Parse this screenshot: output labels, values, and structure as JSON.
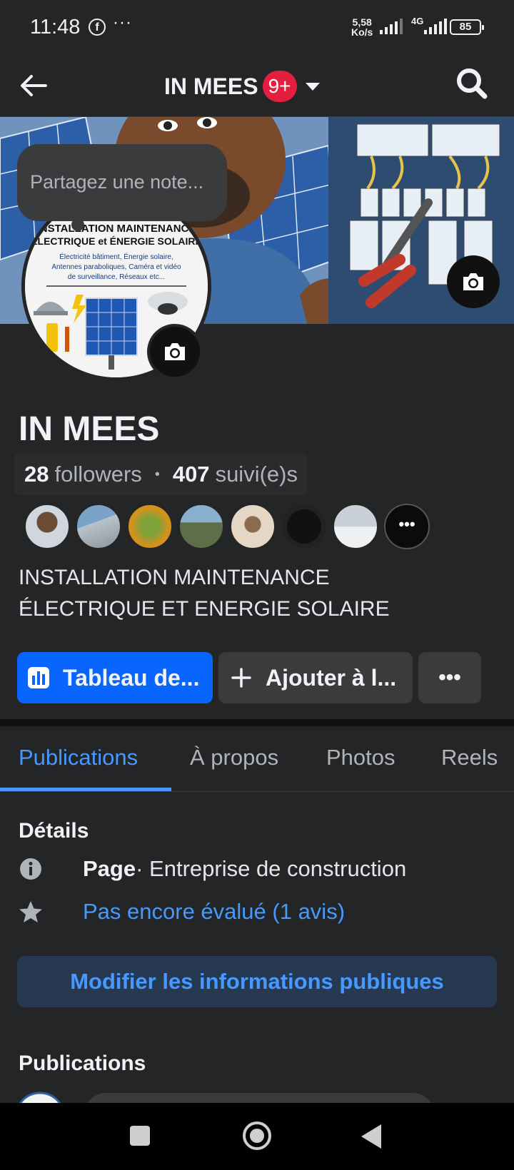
{
  "status_bar": {
    "time": "11:48",
    "fb_glyph": "f",
    "overflow": "···",
    "net_speed_value": "5,58",
    "net_speed_unit": "Ko/s",
    "network": "4G",
    "battery": "85"
  },
  "header": {
    "title": "IN MEES",
    "badge": "9+"
  },
  "cover": {
    "note_placeholder": "Partagez une note...",
    "avatar_lines": [
      "INSTALLATION MAINTENANCE",
      "ÉLECTRIQUE et ÉNERGIE SOLAIRE",
      "Électricité bâtiment, Énergie solaire,",
      "Antennes paraboliques, Caméra et vidéo",
      "de surveillance, Réseaux etc..."
    ]
  },
  "profile": {
    "name": "IN MEES",
    "followers_count": "28",
    "followers_label": "followers",
    "separator": "•",
    "following_count": "407",
    "following_label": "suivi(e)s",
    "more_friends": "•••",
    "bio_line1": "INSTALLATION MAINTENANCE",
    "bio_line2": "ÉLECTRIQUE ET ENERGIE SOLAIRE"
  },
  "actions": {
    "dashboard": "Tableau de...",
    "add": "Ajouter à l...",
    "more": "•••"
  },
  "tabs": [
    "Publications",
    "À propos",
    "Photos",
    "Reels"
  ],
  "details": {
    "title": "Détails",
    "page_label": "Page",
    "page_category": " · Entreprise de construction",
    "rating": "Pas encore évalué (1 avis)",
    "edit_button": "Modifier les informations publiques"
  },
  "publications_title": "Publications",
  "colors": {
    "accent": "#0866ff",
    "link": "#4599ff",
    "bg": "#242526",
    "badge": "#e41e3f"
  }
}
